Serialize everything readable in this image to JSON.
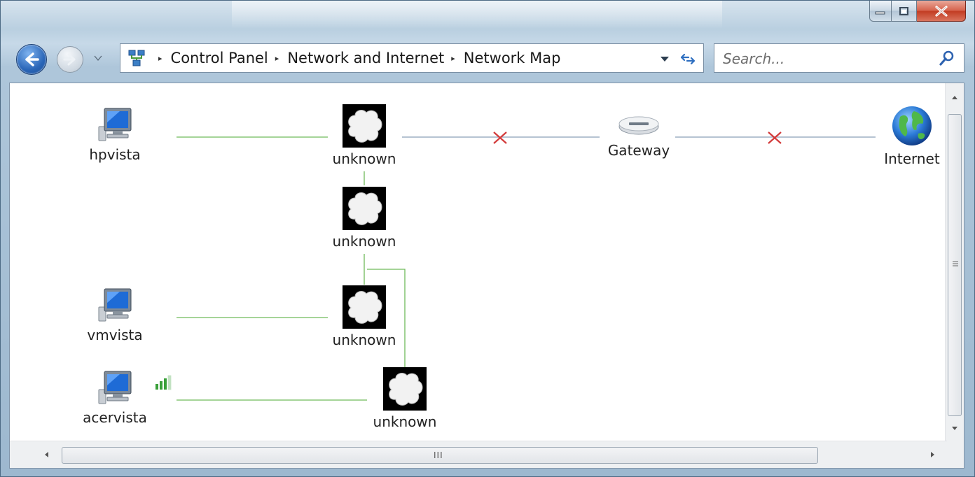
{
  "window": {
    "controls": {
      "minimize_icon": "minimize-icon",
      "maximize_icon": "maximize-icon",
      "close_icon": "close-icon"
    }
  },
  "nav": {
    "back_icon": "back-arrow-icon",
    "forward_icon": "forward-arrow-icon",
    "breadcrumb": [
      "Control Panel",
      "Network and Internet",
      "Network Map"
    ],
    "search_placeholder": "Search..."
  },
  "map": {
    "nodes": {
      "hpvista": "hpvista",
      "vmvista": "vmvista",
      "acervista": "acervista",
      "unknown1": "unknown",
      "unknown2": "unknown",
      "unknown3": "unknown",
      "unknown4": "unknown",
      "gateway": "Gateway",
      "internet": "Internet"
    },
    "colors": {
      "wired_link": "#6fba5a",
      "upstream_link": "#8a9fb6",
      "broken_link_x": "#d33a3a",
      "wireless_signal": "#3aa03a"
    }
  },
  "scrollbars": {
    "hscroll_grip": "III"
  }
}
